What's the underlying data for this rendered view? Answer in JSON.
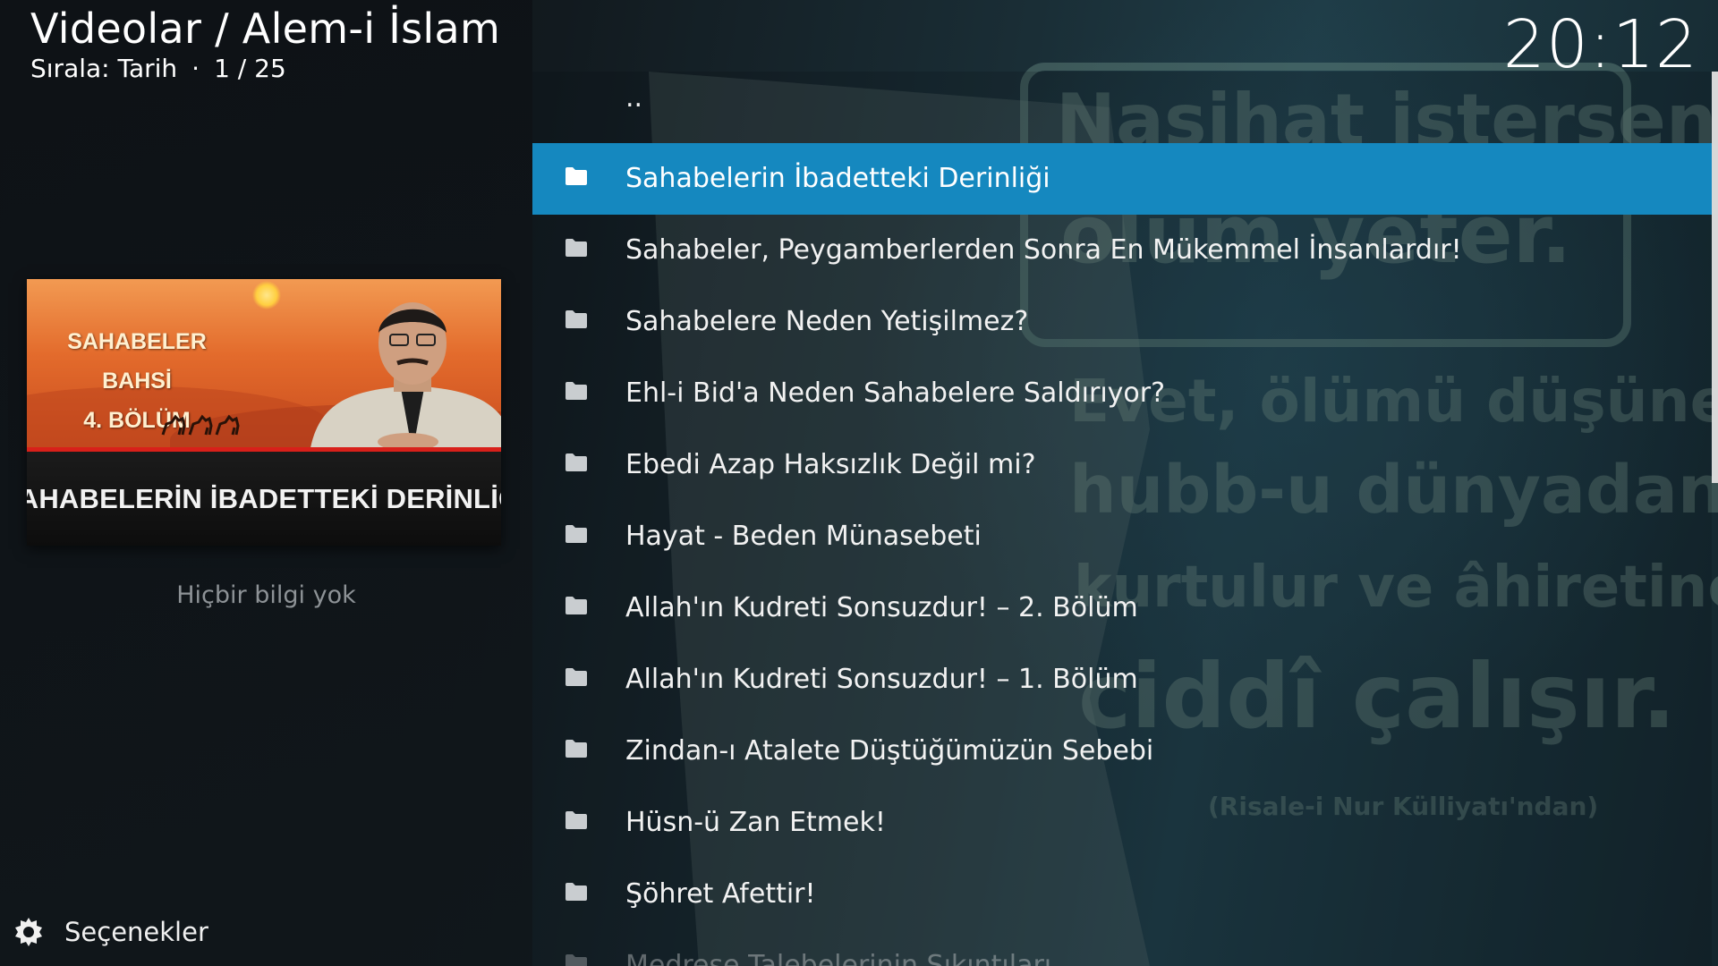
{
  "header": {
    "breadcrumb": "Videolar / Alem-i İslam",
    "sort_label": "Sırala: Tarih",
    "separator": "·",
    "position": "1 / 25"
  },
  "clock": "20:12",
  "preview": {
    "series_line1": "SAHABELER BAHSİ",
    "series_line2": "4. BÖLÜM",
    "caption": "SAHABELERİN İBADETTEKİ DERİNLİĞİ",
    "no_info": "Hiçbir bilgi yok"
  },
  "options": {
    "label": "Seçenekler",
    "icon": "gear-icon"
  },
  "list": {
    "parent_label": "..",
    "selected_index": 0,
    "items": [
      "Sahabelerin İbadetteki Derinliği",
      "Sahabeler, Peygamberlerden Sonra En Mükemmel İnsanlardır!",
      "Sahabelere Neden Yetişilmez?",
      "Ehl-i Bid'a Neden Sahabelere Saldırıyor?",
      "Ebedi Azap Haksızlık Değil mi?",
      "Hayat - Beden Münasebeti",
      "Allah'ın Kudreti Sonsuzdur! – 2. Bölüm",
      "Allah'ın Kudreti Sonsuzdur! – 1. Bölüm",
      "Zindan-ı Atalete Düştüğümüzün Sebebi",
      "Hüsn-ü Zan Etmek!",
      "Şöhret Afettir!",
      "Medrese Talebelerinin Sıkıntıları"
    ],
    "item_icon": "folder-icon"
  },
  "background_poster": {
    "lines": [
      "Nasihat istersen",
      "ölüm yeter.",
      "Evet, ölümü düşünen,",
      "hubb-u dünyadan",
      "kurtulur ve âhiretine",
      "ciddî çalışır.",
      "(Risale-i Nur Külliyatı'ndan)"
    ]
  },
  "colors": {
    "selection": "#1588bf",
    "text": "#f2f2f2",
    "muted": "#8d9296"
  }
}
